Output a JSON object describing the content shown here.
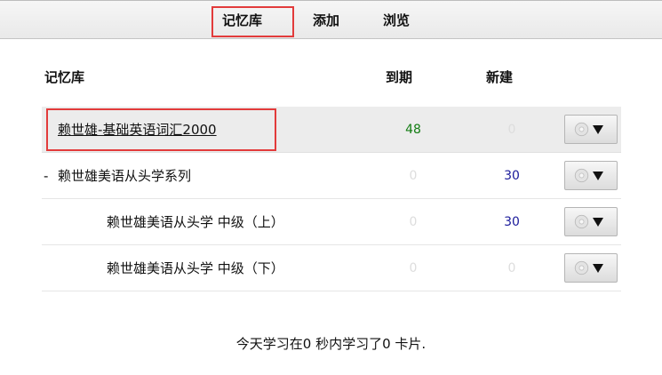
{
  "nav": {
    "decks_label": "记忆库",
    "add_label": "添加",
    "browse_label": "浏览"
  },
  "table": {
    "col_name": "记忆库",
    "col_due": "到期",
    "col_new": "新建"
  },
  "decks": [
    {
      "name": "赖世雄-基础英语词汇2000",
      "due": "48",
      "new": "0",
      "current": true,
      "collapsible": false
    },
    {
      "collapse_symbol": "-",
      "name": "赖世雄美语从头学系列",
      "due": "0",
      "new": "30",
      "current": false,
      "collapsible": true
    },
    {
      "name": "赖世雄美语从头学 中级（上）",
      "due": "0",
      "new": "30",
      "current": false,
      "collapsible": false
    },
    {
      "name": "赖世雄美语从头学 中级（下）",
      "due": "0",
      "new": "0",
      "current": false,
      "collapsible": false
    }
  ],
  "footer": {
    "stats": "今天学习在0 秒内学习了0 卡片."
  },
  "icons": {
    "options_gear": "gear-icon",
    "options_arrow": "triangle-down-icon"
  },
  "colors": {
    "due_count": "#137d13",
    "new_count": "#1a1a9a",
    "zero_count": "#dddddd",
    "highlight_box": "#e23b3b",
    "current_row_bg": "#ececec"
  }
}
